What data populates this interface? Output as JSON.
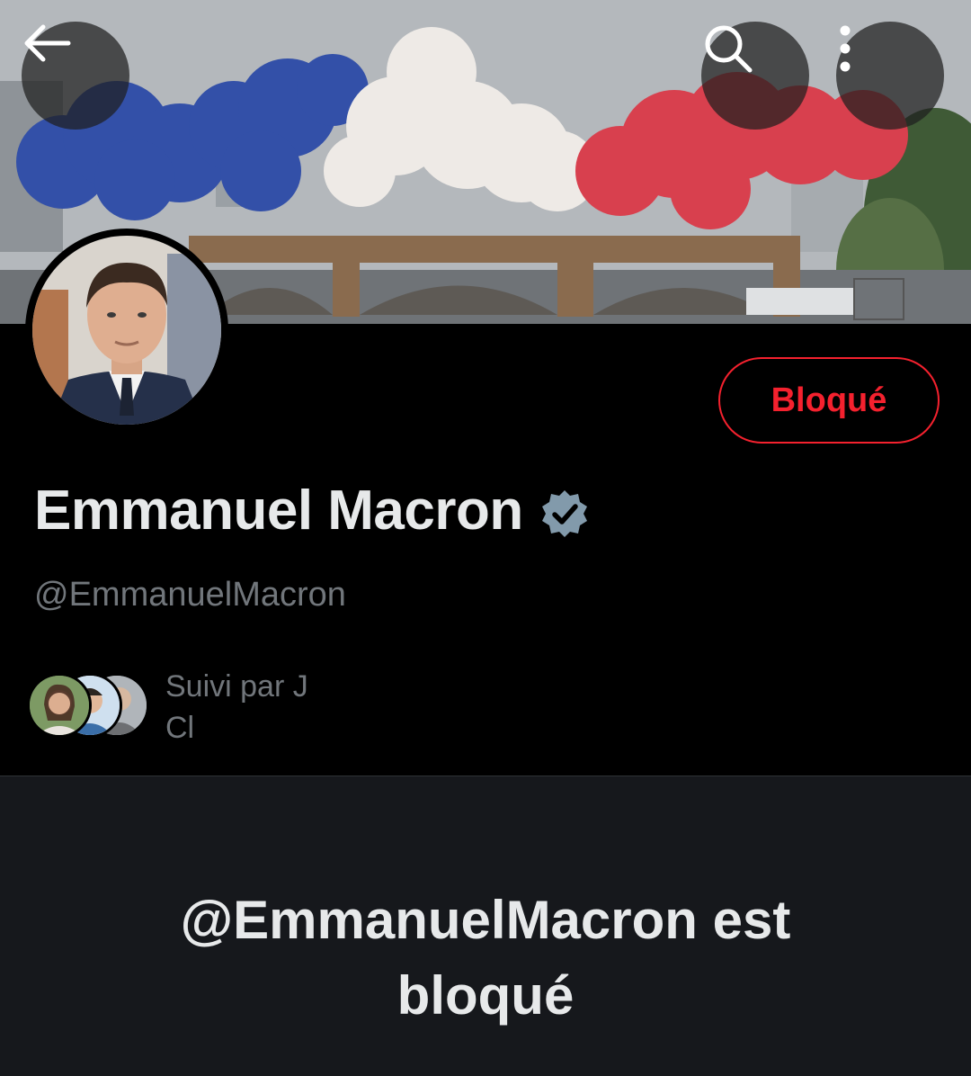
{
  "header": {
    "back_icon": "arrow-left-icon",
    "search_icon": "search-icon",
    "more_icon": "more-vertical-icon"
  },
  "profile": {
    "display_name": "Emmanuel Macron",
    "handle": "@EmmanuelMacron",
    "verified": true,
    "verified_color": "#829aab",
    "block_button_label": "Bloqué",
    "block_color": "#f4212e"
  },
  "followed_by": {
    "line1": "Suivi par J",
    "line2": "Cl"
  },
  "blocked_notice": {
    "message": "@EmmanuelMacron est bloqué"
  }
}
